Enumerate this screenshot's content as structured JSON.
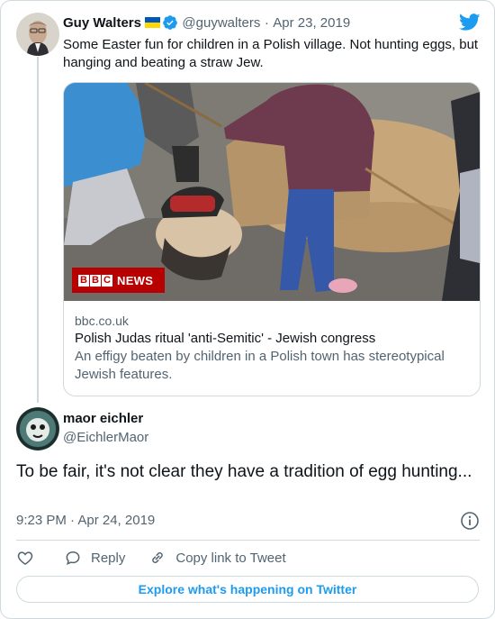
{
  "tweet": {
    "author_name": "Guy Walters",
    "author_handle": "@guywalters",
    "separator": "·",
    "date": "Apr 23, 2019",
    "text": "Some Easter fun for children in a Polish village. Not hunting eggs, but hanging and beating a straw Jew.",
    "flag_icon": "ukraine-flag-icon",
    "verified_icon": "verified-badge-icon",
    "platform_icon": "twitter-bird-icon"
  },
  "link_card": {
    "image_logo_text": "NEWS",
    "image_logo_letters": [
      "B",
      "B",
      "C"
    ],
    "domain": "bbc.co.uk",
    "title": "Polish Judas ritual 'anti-Semitic' - Jewish congress",
    "description": "An effigy beaten by children in a Polish town has stereotypical Jewish features."
  },
  "reply": {
    "author_name": "maor eichler",
    "author_handle": "@EichlerMaor",
    "text": "To be fair, it's not clear they have a tradition of egg hunting...",
    "timestamp": "9:23 PM · Apr 24, 2019"
  },
  "actions": {
    "like_icon": "heart-icon",
    "reply_label": "Reply",
    "copy_link_label": "Copy link to Tweet"
  },
  "explore_label": "Explore what's happening on Twitter",
  "colors": {
    "accent": "#1d9bf0",
    "text": "#0f1419",
    "muted": "#536471",
    "border": "#cfd9de",
    "bbc_red": "#b80000"
  }
}
